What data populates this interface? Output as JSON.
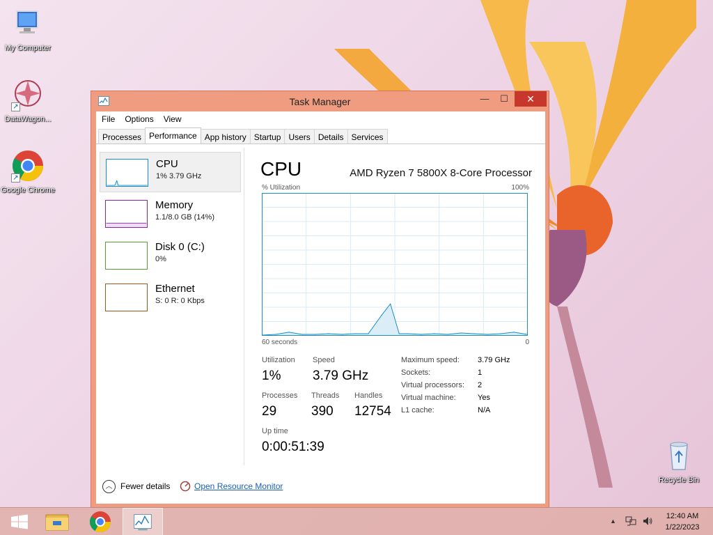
{
  "desktop": {
    "icons": [
      {
        "label": "My Computer"
      },
      {
        "label": "DataWagon..."
      },
      {
        "label": "Google Chrome"
      },
      {
        "label": "Recycle Bin"
      }
    ]
  },
  "window": {
    "title": "Task Manager",
    "controls": {
      "minimize": "—",
      "maximize": "☐",
      "close": "✕"
    },
    "menu": [
      "File",
      "Options",
      "View"
    ],
    "tabs": [
      "Processes",
      "Performance",
      "App history",
      "Startup",
      "Users",
      "Details",
      "Services"
    ],
    "active_tab": "Performance"
  },
  "sidebar": {
    "items": [
      {
        "name": "CPU",
        "detail": "1%  3.79 GHz",
        "color": "#1b8ec5"
      },
      {
        "name": "Memory",
        "detail": "1.1/8.0 GB (14%)",
        "color": "#8b21a6"
      },
      {
        "name": "Disk 0 (C:)",
        "detail": "0%",
        "color": "#4da32b"
      },
      {
        "name": "Ethernet",
        "detail": "S: 0  R: 0 Kbps",
        "color": "#a6531a"
      }
    ]
  },
  "detail": {
    "title": "CPU",
    "model": "AMD Ryzen 7 5800X 8-Core Processor",
    "util_label": "% Utilization",
    "util_max": "100%",
    "time_label": "60 seconds",
    "time_min": "0",
    "stats": {
      "utilization": {
        "label": "Utilization",
        "value": "1%"
      },
      "speed": {
        "label": "Speed",
        "value": "3.79 GHz"
      },
      "processes": {
        "label": "Processes",
        "value": "29"
      },
      "threads": {
        "label": "Threads",
        "value": "390"
      },
      "handles": {
        "label": "Handles",
        "value": "12754"
      },
      "uptime": {
        "label": "Up time",
        "value": "0:00:51:39"
      }
    },
    "specs": [
      {
        "label": "Maximum speed:",
        "value": "3.79 GHz"
      },
      {
        "label": "Sockets:",
        "value": "1"
      },
      {
        "label": "Virtual processors:",
        "value": "2"
      },
      {
        "label": "Virtual machine:",
        "value": "Yes"
      },
      {
        "label": "L1 cache:",
        "value": "N/A"
      }
    ]
  },
  "footer": {
    "fewer_details": "Fewer details",
    "resource_monitor": "Open Resource Monitor"
  },
  "taskbar": {
    "clock_time": "12:40 AM",
    "clock_date": "1/22/2023"
  },
  "colors": {
    "cpu_line": "#1b8ec5",
    "cpu_fill": "#dbeef8",
    "window_frame": "#ef9c80",
    "close_button": "#c7372b"
  },
  "chart_data": {
    "type": "area",
    "ylabel": "% Utilization",
    "xlabel": "60 seconds",
    "xlim": [
      60,
      0
    ],
    "ylim": [
      0,
      100
    ],
    "grid": true,
    "series": [
      {
        "x": [
          60,
          57,
          54,
          51,
          48,
          45,
          42,
          39,
          36,
          33,
          31,
          29,
          27,
          24,
          21,
          18,
          15,
          12,
          9,
          6,
          3,
          0
        ],
        "values": [
          0,
          0.5,
          2,
          0.5,
          0.5,
          1,
          0.5,
          1,
          1,
          14,
          22,
          1,
          1,
          0.5,
          1,
          0.5,
          1.5,
          1,
          0.5,
          1,
          2,
          0.5
        ]
      }
    ]
  }
}
